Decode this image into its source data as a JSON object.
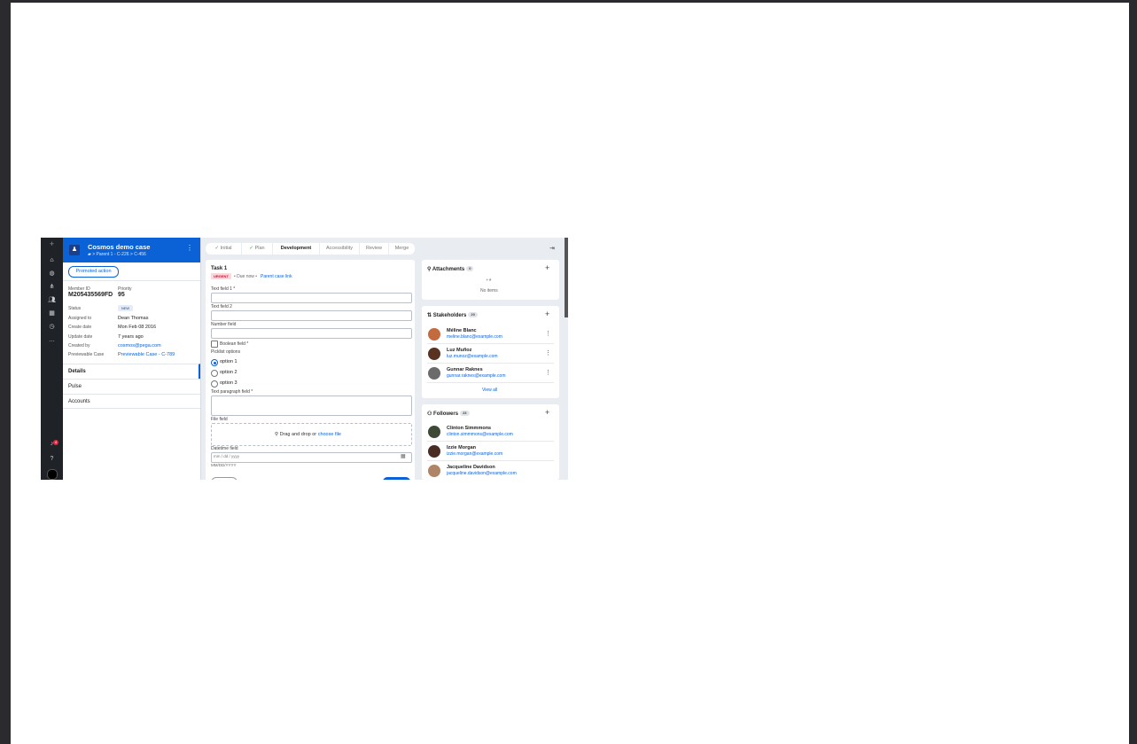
{
  "case": {
    "title": "Cosmos demo case",
    "breadcrumb": "> Parent 1 - C-226 > C-456",
    "promoted_action": "Promoted action",
    "summary": {
      "member_id_label": "Member ID",
      "member_id": "M205435569FD",
      "priority_label": "Priority",
      "priority": "95",
      "status_label": "Status",
      "status": "NEW",
      "assigned_to_label": "Assigned to",
      "assigned_to": "Dean Thomas",
      "create_date_label": "Create date",
      "create_date": "Mon Feb 08 2016",
      "update_date_label": "Update date",
      "update_date": "7 years ago",
      "created_by_label": "Created by",
      "created_by": "cosmos@pega.com",
      "previewable_label": "Previewable Case",
      "previewable": "Previewable Case - C-789"
    },
    "tabs": [
      "Details",
      "Pulse",
      "Accounts"
    ]
  },
  "stages": [
    "Initial",
    "Plan",
    "Development",
    "Accessibility",
    "Review",
    "Merge"
  ],
  "task": {
    "title": "Task 1",
    "urgency": "URGENT",
    "due": "• Due now •",
    "parent_link": "Parent case link",
    "text_field_1": "Text field 1 *",
    "text_field_2": "Text field 2",
    "number_field": "Number field",
    "boolean_field": "Boolean field *",
    "picklist_label": "Picklist options",
    "options": [
      "option 1",
      "option 2",
      "option 3"
    ],
    "paragraph_field": "Text paragraph field *",
    "file_field": "File field",
    "drag_text": "Drag and drop or",
    "choose_file": "choose file",
    "datetime_field": "Datetime field",
    "datetime_placeholder": "mm / dd / yyyy",
    "date_format": "MM/DD/YYYY"
  },
  "attachments": {
    "title": "Attachments",
    "count": "0",
    "empty": "No items"
  },
  "stakeholders": {
    "title": "Stakeholders",
    "count": "20",
    "view_all": "View all",
    "people": [
      {
        "name": "Méline Blanc",
        "email": "meline.blanc@example.com"
      },
      {
        "name": "Luz Muñoz",
        "email": "luz.munoz@example.com"
      },
      {
        "name": "Gunnar Raknes",
        "email": "gunnar.raknes@example.com"
      }
    ]
  },
  "followers": {
    "title": "Followers",
    "count": "23",
    "people": [
      {
        "name": "Clinton Simmmons",
        "email": "clinton.simmmons@example.com"
      },
      {
        "name": "Izzie Morgan",
        "email": "izzie.morgan@example.com"
      },
      {
        "name": "Jacqueline Davidson",
        "email": "jacqueline.davidson@example.com"
      }
    ]
  },
  "notifications": {
    "count": "4"
  },
  "colors": {
    "brand": "#0a62d6",
    "nav": "#1f2328",
    "urgent": "#c8102e"
  }
}
